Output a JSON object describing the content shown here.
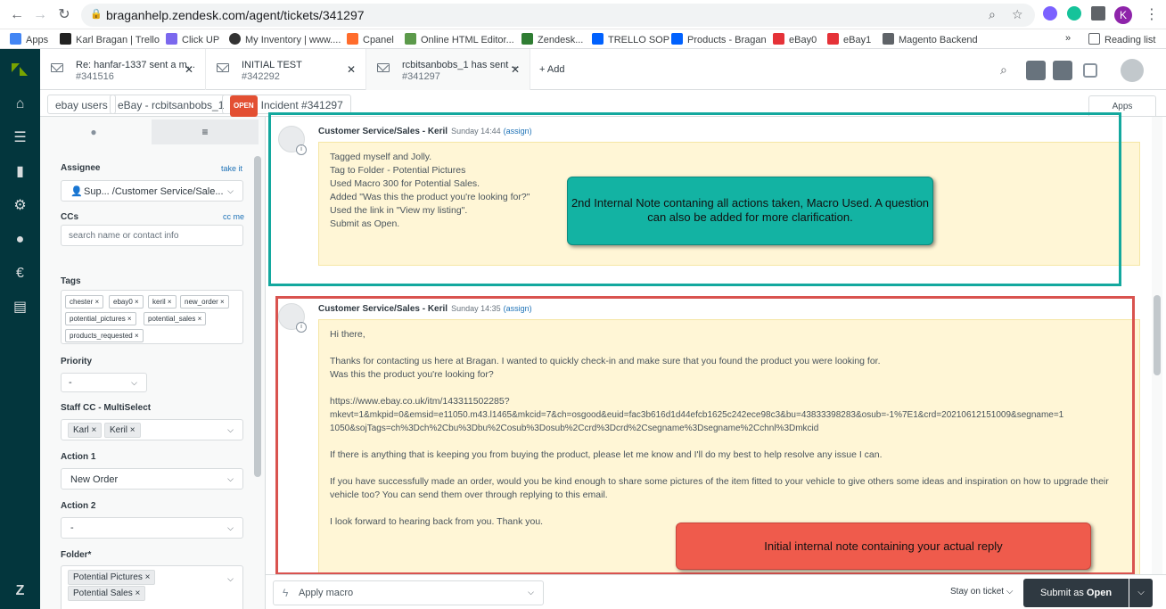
{
  "browser": {
    "url": "braganhelp.zendesk.com/agent/tickets/341297",
    "profile_initial": "K",
    "bookmarks": [
      {
        "label": "Apps",
        "color": "#4285f4"
      },
      {
        "label": "Karl Bragan | Trello",
        "color": "#222222"
      },
      {
        "label": "Click UP",
        "color": "#7b68ee"
      },
      {
        "label": "My Inventory | www....",
        "color": "#333333"
      },
      {
        "label": "Cpanel",
        "color": "#ff6c2c"
      },
      {
        "label": "Online HTML Editor...",
        "color": "#5c9a4b"
      },
      {
        "label": "Zendesk...",
        "color": "#2f7d33"
      },
      {
        "label": "TRELLO SOP",
        "color": "#0061fe"
      },
      {
        "label": "Products - Bragan",
        "color": "#0061fe"
      },
      {
        "label": "eBay0",
        "color": "#e53238"
      },
      {
        "label": "eBay1",
        "color": "#e53238"
      },
      {
        "label": "Magento Backend",
        "color": "#5f6368"
      }
    ],
    "more_bookmarks": "»",
    "reading_list": "Reading list"
  },
  "tabs": [
    {
      "title": "Re: hanfar-1337 sent a m...",
      "id": "#341516"
    },
    {
      "title": "INITIAL TEST",
      "id": "#342292"
    },
    {
      "title": "rcbitsanbobs_1 has sent ...",
      "id": "#341297"
    }
  ],
  "add_tab_label": "+ Add",
  "breadcrumbs": {
    "org": "ebay users",
    "requester": "eBay - rcbitsanbobs_1",
    "status_badge": "OPEN",
    "ticket": "Incident #341297"
  },
  "apps_label": "Apps",
  "properties": {
    "assignee_label": "Assignee",
    "take_it": "take it",
    "assignee_value": "Sup...  /Customer Service/Sale...",
    "ccs_label": "CCs",
    "cc_me": "cc me",
    "cc_placeholder": "search name or contact info",
    "tags_label": "Tags",
    "tags": [
      "chester ×",
      "ebay0 ×",
      "keril ×",
      "new_order ×",
      "potential_pictures ×",
      "potential_sales ×",
      "products_requested ×"
    ],
    "priority_label": "Priority",
    "priority_value": "-",
    "staff_cc_label": "Staff CC - MultiSelect",
    "staff_cc_values": [
      "Karl ×",
      "Keril ×"
    ],
    "action1_label": "Action 1",
    "action1_value": "New Order",
    "action2_label": "Action 2",
    "action2_value": "-",
    "folder_label": "Folder*",
    "folder_values": [
      "Potential Pictures ×",
      "Potential Sales ×"
    ]
  },
  "notes": [
    {
      "author": "Customer Service/Sales - Keril",
      "time": "Sunday 14:44",
      "assign": "(assign)",
      "lines": [
        "Tagged myself and Jolly.",
        "Tag to Folder - Potential Pictures",
        "Used Macro 300 for Potential Sales.",
        "Added \"Was this the product you're looking for?\"",
        "Used the link in \"View my listing\".",
        "Submit as Open."
      ]
    },
    {
      "author": "Customer Service/Sales - Keril",
      "time": "Sunday 14:35",
      "assign": "(assign)",
      "greeting": "Hi there,",
      "p1a": "Thanks for contacting us here at Bragan. I wanted to quickly check-in and make sure that you found the product you were looking for.",
      "p1b": "Was this the product you're looking for?",
      "link1": "https://www.ebay.co.uk/itm/143311502285?",
      "link2": "mkevt=1&mkpid=0&emsid=e11050.m43.l1465&mkcid=7&ch=osgood&euid=fac3b616d1d44efcb1625c242ece98c3&bu=43833398283&osub=-1%7E1&crd=20210612151009&segname=1",
      "link3": "1050&sojTags=ch%3Dch%2Cbu%3Dbu%2Cosub%3Dosub%2Ccrd%3Dcrd%2Csegname%3Dsegname%2Cchnl%3Dmkcid",
      "p2": "If there is anything that is keeping you from buying the product, please let me know and I'll do my best to help resolve any issue I can.",
      "p3": "If you have successfully made an order, would you be kind enough to share some pictures of the item fitted to your vehicle to give others some ideas and inspiration on how to upgrade their vehicle too? You can send them over through replying to this email.",
      "p4": "I look forward to hearing back from you. Thank you."
    }
  ],
  "callouts": {
    "teal": "2nd Internal Note contaning all actions taken, Macro Used. A question can also be added for more clarification.",
    "red": "Initial internal note containing your actual reply"
  },
  "bottom": {
    "apply_macro": "Apply macro",
    "stay_on_ticket": "Stay on ticket",
    "submit_prefix": "Submit as ",
    "submit_status": "Open"
  },
  "colors": {
    "zendesk_nav": "#03363d",
    "note_bg": "#fff6d6",
    "teal_frame": "#13a89e",
    "red_frame": "#d9534f",
    "submit": "#2f3941"
  }
}
